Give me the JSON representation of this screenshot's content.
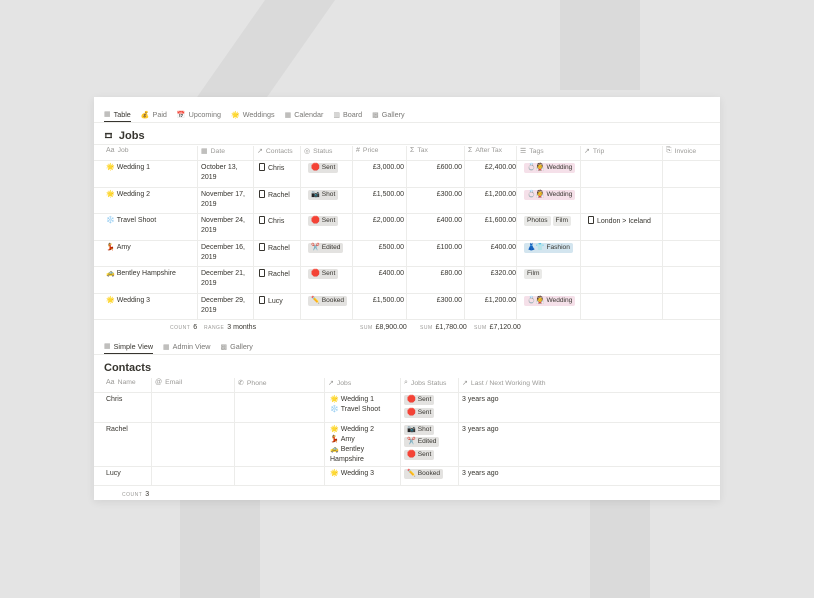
{
  "views_top": [
    {
      "icon": "table-icon",
      "glyph": "▦",
      "label": "Table",
      "active": true
    },
    {
      "icon": "money-bag-icon",
      "glyph": "💰",
      "label": "Paid"
    },
    {
      "icon": "calendar-emoji-icon",
      "glyph": "📅",
      "label": "Upcoming"
    },
    {
      "icon": "sparkles-icon",
      "glyph": "🌟",
      "label": "Weddings"
    },
    {
      "icon": "calendar-icon",
      "glyph": "▦",
      "label": "Calendar"
    },
    {
      "icon": "board-icon",
      "glyph": "▥",
      "label": "Board"
    },
    {
      "icon": "gallery-icon",
      "glyph": "▩",
      "label": "Gallery"
    }
  ],
  "jobs": {
    "title_emoji": "🎞",
    "title": "Jobs",
    "columns": {
      "job": {
        "icon": "Aa",
        "label": "Job"
      },
      "date": {
        "icon": "▦",
        "label": "Date"
      },
      "contacts": {
        "icon": "↗",
        "label": "Contacts"
      },
      "status": {
        "icon": "◎",
        "label": "Status"
      },
      "price": {
        "icon": "#",
        "label": "Price"
      },
      "tax": {
        "icon": "Σ",
        "label": "Tax"
      },
      "after_tax": {
        "icon": "Σ",
        "label": "After Tax"
      },
      "tags": {
        "icon": "☰",
        "label": "Tags"
      },
      "trip": {
        "icon": "↗",
        "label": "Trip"
      },
      "invoice": {
        "icon": "⎘",
        "label": "Invoice"
      }
    },
    "rows": [
      {
        "emoji": "🌟",
        "job": "Wedding 1",
        "date1": "October 13,",
        "date2": "2019",
        "contact": "Chris",
        "status_emoji": "🛑",
        "status": "Sent",
        "price": "£3,000.00",
        "tax": "£600.00",
        "after_tax": "£2,400.00",
        "tags": [
          {
            "emoji": "💍👰",
            "label": "Wedding",
            "style": "pink"
          }
        ],
        "trip": ""
      },
      {
        "emoji": "🌟",
        "job": "Wedding 2",
        "date1": "November 17,",
        "date2": "2019",
        "contact": "Rachel",
        "status_emoji": "📷",
        "status": "Shot",
        "price": "£1,500.00",
        "tax": "£300.00",
        "after_tax": "£1,200.00",
        "tags": [
          {
            "emoji": "💍👰",
            "label": "Wedding",
            "style": "pink"
          }
        ],
        "trip": ""
      },
      {
        "emoji": "❄️",
        "job": "Travel Shoot",
        "date1": "November 24,",
        "date2": "2019",
        "contact": "Chris",
        "status_emoji": "🛑",
        "status": "Sent",
        "price": "£2,000.00",
        "tax": "£400.00",
        "after_tax": "£1,600.00",
        "tags": [
          {
            "emoji": "",
            "label": "Photos",
            "style": "grey"
          },
          {
            "emoji": "",
            "label": "Film",
            "style": "grey"
          }
        ],
        "trip": "London > Iceland"
      },
      {
        "emoji": "💃",
        "job": "Amy",
        "date1": "December 16,",
        "date2": "2019",
        "contact": "Rachel",
        "status_emoji": "✂️",
        "status": "Edited",
        "price": "£500.00",
        "tax": "£100.00",
        "after_tax": "£400.00",
        "tags": [
          {
            "emoji": "👗👕",
            "label": "Fashion",
            "style": "blue"
          }
        ],
        "trip": ""
      },
      {
        "emoji": "🚕",
        "job": "Bentley Hampshire",
        "date1": "December 21,",
        "date2": "2019",
        "contact": "Rachel",
        "status_emoji": "🛑",
        "status": "Sent",
        "price": "£400.00",
        "tax": "£80.00",
        "after_tax": "£320.00",
        "tags": [
          {
            "emoji": "",
            "label": "Film",
            "style": "grey"
          }
        ],
        "trip": ""
      },
      {
        "emoji": "🌟",
        "job": "Wedding 3",
        "date1": "December 29,",
        "date2": "2019",
        "contact": "Lucy",
        "status_emoji": "✏️",
        "status": "Booked",
        "price": "£1,500.00",
        "tax": "£300.00",
        "after_tax": "£1,200.00",
        "tags": [
          {
            "emoji": "💍👰",
            "label": "Wedding",
            "style": "pink"
          }
        ],
        "trip": ""
      }
    ],
    "footer": {
      "count_label": "COUNT",
      "count": "6",
      "range_label": "RANGE",
      "range": "3 months",
      "sum_label": "SUM",
      "sum_price": "£8,900.00",
      "sum_tax": "£1,780.00",
      "sum_after_tax": "£7,120.00"
    }
  },
  "views_bottom": [
    {
      "icon": "table-icon",
      "glyph": "▦",
      "label": "Simple View",
      "active": true
    },
    {
      "icon": "table-icon",
      "glyph": "▦",
      "label": "Admin View"
    },
    {
      "icon": "gallery-icon",
      "glyph": "▩",
      "label": "Gallery"
    }
  ],
  "contacts": {
    "title": "Contacts",
    "columns": {
      "name": {
        "icon": "Aa",
        "label": "Name"
      },
      "email": {
        "icon": "@",
        "label": "Email"
      },
      "phone": {
        "icon": "✆",
        "label": "Phone"
      },
      "jobs": {
        "icon": "↗",
        "label": "Jobs"
      },
      "jobs_status": {
        "icon": "⌕",
        "label": "Jobs Status"
      },
      "last_next": {
        "icon": "↗",
        "label": "Last / Next Working With"
      }
    },
    "rows": [
      {
        "name": "Chris",
        "jobs": [
          {
            "emoji": "🌟",
            "label": "Wedding 1"
          },
          {
            "emoji": "❄️",
            "label": "Travel Shoot"
          }
        ],
        "statuses": [
          {
            "emoji": "🛑",
            "label": "Sent"
          },
          {
            "emoji": "🛑",
            "label": "Sent"
          }
        ],
        "last": "3 years ago"
      },
      {
        "name": "Rachel",
        "jobs": [
          {
            "emoji": "🌟",
            "label": "Wedding 2"
          },
          {
            "emoji": "💃",
            "label": "Amy"
          },
          {
            "emoji": "🚕",
            "label": "Bentley"
          },
          {
            "emoji": "",
            "label": "Hampshire"
          }
        ],
        "statuses": [
          {
            "emoji": "📷",
            "label": "Shot"
          },
          {
            "emoji": "✂️",
            "label": "Edited"
          },
          {
            "emoji": "🛑",
            "label": "Sent"
          }
        ],
        "last": "3 years ago"
      },
      {
        "name": "Lucy",
        "jobs": [
          {
            "emoji": "🌟",
            "label": "Wedding 3"
          }
        ],
        "statuses": [
          {
            "emoji": "✏️",
            "label": "Booked"
          }
        ],
        "last": "3 years ago"
      }
    ],
    "footer": {
      "count_label": "COUNT",
      "count": "3"
    }
  }
}
